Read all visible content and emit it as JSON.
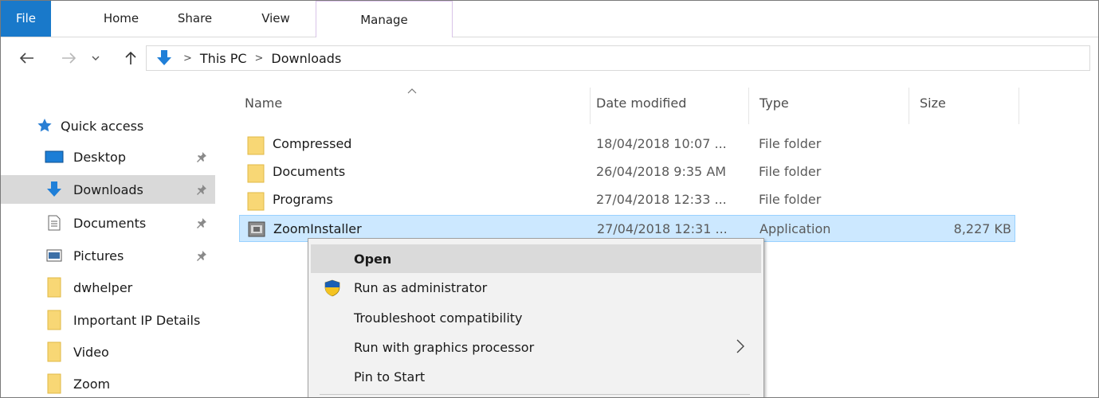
{
  "ribbon": {
    "tabs": {
      "file": "File",
      "home": "Home",
      "share": "Share",
      "view": "View",
      "manage": "Manage"
    }
  },
  "address": {
    "segments": [
      "This PC",
      "Downloads"
    ]
  },
  "nav": {
    "quick_access": "Quick access",
    "items": [
      {
        "label": "Desktop",
        "pinned": true
      },
      {
        "label": "Downloads",
        "pinned": true,
        "selected": true
      },
      {
        "label": "Documents",
        "pinned": true
      },
      {
        "label": "Pictures",
        "pinned": true
      },
      {
        "label": "dwhelper"
      },
      {
        "label": "Important IP Details"
      },
      {
        "label": "Video"
      },
      {
        "label": "Zoom"
      }
    ]
  },
  "columns": {
    "name": "Name",
    "date": "Date modified",
    "type": "Type",
    "size": "Size"
  },
  "files": [
    {
      "name": "Compressed",
      "date": "18/04/2018 10:07 ...",
      "type": "File folder",
      "size": ""
    },
    {
      "name": "Documents",
      "date": "26/04/2018 9:35 AM",
      "type": "File folder",
      "size": ""
    },
    {
      "name": "Programs",
      "date": "27/04/2018 12:33 ...",
      "type": "File folder",
      "size": ""
    },
    {
      "name": "ZoomInstaller",
      "date": "27/04/2018 12:31 ...",
      "type": "Application",
      "size": "8,227 KB",
      "selected": true
    }
  ],
  "context_menu": {
    "items": [
      {
        "label": "Open"
      },
      {
        "label": "Run as administrator"
      },
      {
        "label": "Troubleshoot compatibility"
      },
      {
        "label": "Run with graphics processor"
      },
      {
        "label": "Pin to Start"
      }
    ]
  },
  "colors": {
    "accent": "#1979ca",
    "selection": "#cce8ff",
    "folder": "#f8d775"
  }
}
